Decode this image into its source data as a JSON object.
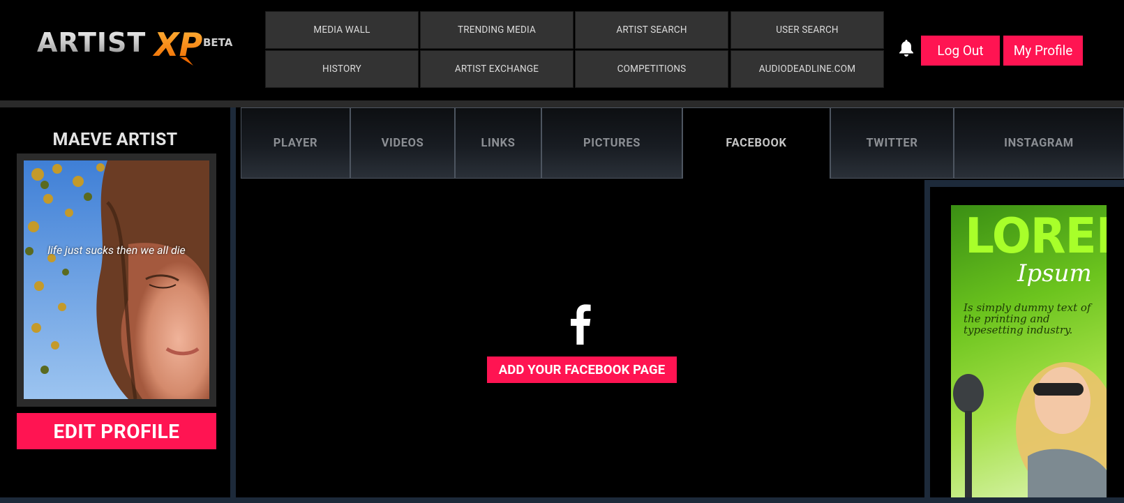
{
  "header": {
    "logo": {
      "text": "ARTIST",
      "accent": "XP",
      "badge": "BETA"
    },
    "nav": [
      {
        "label": "MEDIA WALL"
      },
      {
        "label": "TRENDING MEDIA"
      },
      {
        "label": "ARTIST SEARCH"
      },
      {
        "label": "USER SEARCH"
      },
      {
        "label": "HISTORY"
      },
      {
        "label": "ARTIST EXCHANGE"
      },
      {
        "label": "COMPETITIONS"
      },
      {
        "label": "AUDIODEADLINE.COM"
      }
    ],
    "notifications_icon": "bell-icon",
    "logout_label": "Log Out",
    "my_profile_label": "My Profile"
  },
  "sidebar": {
    "artist_name": "MAEVE ARTIST",
    "photo_caption": "life just sucks then we all die",
    "edit_profile_label": "EDIT PROFILE"
  },
  "tabs": [
    {
      "label": "PLAYER",
      "active": false
    },
    {
      "label": "VIDEOS",
      "active": false
    },
    {
      "label": "LINKS",
      "active": false
    },
    {
      "label": "PICTURES",
      "active": false
    },
    {
      "label": "FACEBOOK",
      "active": true
    },
    {
      "label": "TWITTER",
      "active": false
    },
    {
      "label": "INSTAGRAM",
      "active": false
    }
  ],
  "main": {
    "icon": "facebook-icon",
    "add_facebook_label": "ADD YOUR FACEBOOK PAGE"
  },
  "ad": {
    "title": "LOREM",
    "subtitle": "Ipsum",
    "text": "Is simply dummy text of the printing and typesetting industry."
  },
  "colors": {
    "accent": "#ff1452",
    "nav_button": "#333333",
    "divider": "#1d2a3a",
    "logo_orange": "#f7931e"
  }
}
